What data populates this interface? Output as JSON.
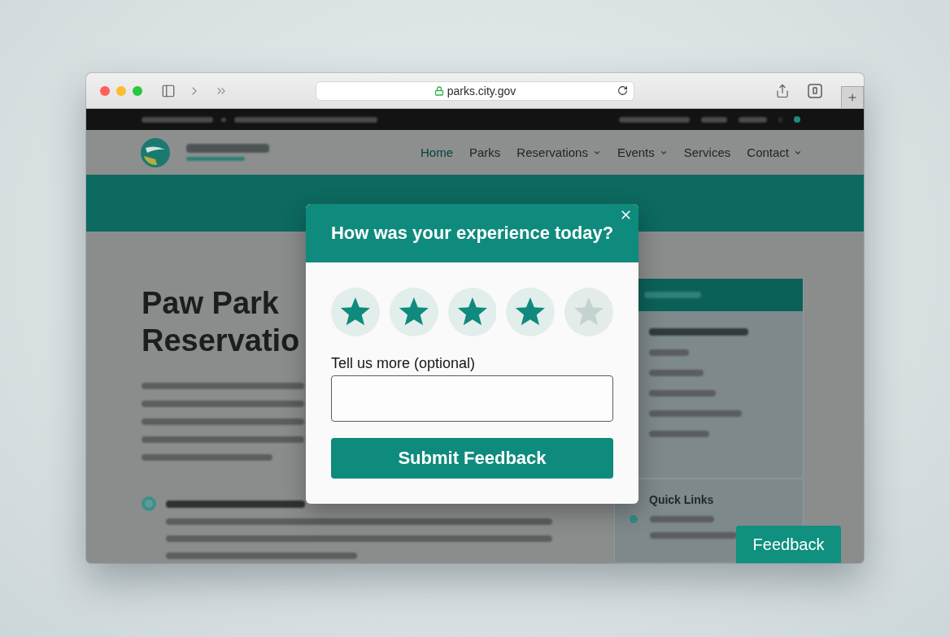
{
  "browser": {
    "url": "parks.city.gov"
  },
  "page": {
    "nav": [
      {
        "label": "Home",
        "selected": true,
        "has_menu": false
      },
      {
        "label": "Parks",
        "selected": false,
        "has_menu": false
      },
      {
        "label": "Reservations",
        "selected": false,
        "has_menu": true
      },
      {
        "label": "Events",
        "selected": false,
        "has_menu": true
      },
      {
        "label": "Services",
        "selected": false,
        "has_menu": false
      },
      {
        "label": "Contact",
        "selected": false,
        "has_menu": true
      }
    ],
    "heading": "Paw Park Reservatio",
    "sidebar": {
      "section_title": "Quick Links"
    }
  },
  "feedback_dialog": {
    "title": "How was your experience today?",
    "stars": 4,
    "comment": {
      "label": "Tell us more (optional)"
    },
    "submit_button": "Submit Feedback"
  },
  "feedback_tab": {
    "label": "Feedback"
  }
}
